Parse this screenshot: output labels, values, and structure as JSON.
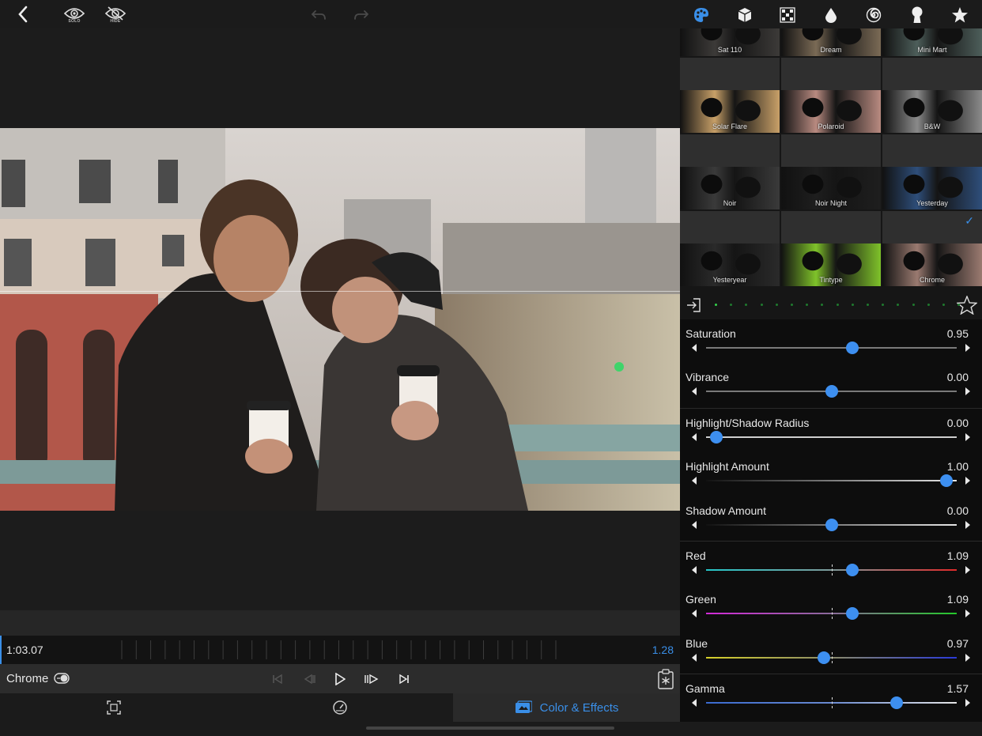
{
  "toolbar": {
    "solo_label": "SOLO",
    "hide_label": "HIDE"
  },
  "timeline": {
    "current_time": "1:03.07",
    "duration": "1.28"
  },
  "transport": {
    "clip_name": "Chrome"
  },
  "tabs": [
    {
      "label": "",
      "icon": "crop-icon"
    },
    {
      "label": "",
      "icon": "speed-icon"
    },
    {
      "label": "Color & Effects",
      "icon": "color-effects-icon",
      "active": true
    }
  ],
  "panel_tabs": [
    "palette-icon",
    "cube-icon",
    "pattern-icon",
    "drop-icon",
    "spiral-icon",
    "keyhole-icon",
    "star-icon"
  ],
  "presets": [
    {
      "name": "Sat 110",
      "tint": "#3c3a38"
    },
    {
      "name": "Dream",
      "tint": "#7a6a55"
    },
    {
      "name": "Mini Mart",
      "tint": "#4d5e5a"
    },
    {
      "name": "Solar Flare",
      "tint": "#c8a068"
    },
    {
      "name": "Polaroid",
      "tint": "#b88a80"
    },
    {
      "name": "B&W",
      "tint": "#8a8a8a"
    },
    {
      "name": "Noir",
      "tint": "#3a3a3a"
    },
    {
      "name": "Noir Night",
      "tint": "#1e1e1e"
    },
    {
      "name": "Yesterday",
      "tint": "#2e4e7a"
    },
    {
      "name": "Yesteryear",
      "tint": "#2a2a2a"
    },
    {
      "name": "Tintype",
      "tint": "#7fc22a"
    },
    {
      "name": "Chrome",
      "tint": "#9a7a70",
      "selected": true
    }
  ],
  "preset_nav": {
    "dots": 17,
    "active_dot": 0
  },
  "sliders": [
    {
      "label": "Saturation",
      "value": "0.95",
      "fraction": 0.585,
      "track": "gray"
    },
    {
      "label": "Vibrance",
      "value": "0.00",
      "fraction": 0.5,
      "track": "gray"
    },
    {
      "label": "Highlight/Shadow Radius",
      "value": "0.00",
      "fraction": 0.04,
      "track": "light"
    },
    {
      "label": "Highlight Amount",
      "value": "1.00",
      "fraction": 0.96,
      "track": "dark-to-light"
    },
    {
      "label": "Shadow Amount",
      "value": "0.00",
      "fraction": 0.5,
      "track": "dark-to-light"
    },
    {
      "label": "Red",
      "value": "1.09",
      "fraction": 0.583,
      "track": "red"
    },
    {
      "label": "Green",
      "value": "1.09",
      "fraction": 0.583,
      "track": "green"
    },
    {
      "label": "Blue",
      "value": "0.97",
      "fraction": 0.47,
      "track": "blue"
    },
    {
      "label": "Gamma",
      "value": "1.57",
      "fraction": 0.76,
      "track": "gamma"
    }
  ],
  "colors": {
    "accent": "#3a8fe8",
    "knob": "#3d8ff0",
    "nav_dot": "#33d24a"
  }
}
